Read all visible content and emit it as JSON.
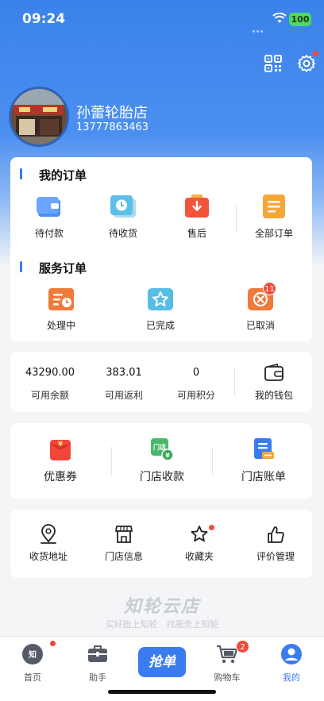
{
  "status_bar": {
    "time": "09:24",
    "battery": "100"
  },
  "profile": {
    "shop_name": "孙蕾轮胎店",
    "phone": "13777863463"
  },
  "my_orders": {
    "title": "我的订单",
    "items": [
      {
        "label": "待付款",
        "icon": "wallet-icon"
      },
      {
        "label": "待收货",
        "icon": "clock-icon"
      },
      {
        "label": "售后",
        "icon": "after-sale-icon"
      },
      {
        "label": "全部订单",
        "icon": "document-list-icon"
      }
    ]
  },
  "service_orders": {
    "title": "服务订单",
    "items": [
      {
        "label": "处理中",
        "icon": "processing-icon"
      },
      {
        "label": "已完成",
        "icon": "star-icon"
      },
      {
        "label": "已取消",
        "icon": "cancel-icon",
        "badge": "11"
      }
    ]
  },
  "wallet": {
    "items": [
      {
        "value": "43290.00",
        "label": "可用余额"
      },
      {
        "value": "383.01",
        "label": "可用返利"
      },
      {
        "value": "0",
        "label": "可用积分"
      }
    ],
    "my_wallet": "我的钱包"
  },
  "finance": {
    "items": [
      {
        "label": "优惠券",
        "icon": "coupon-icon"
      },
      {
        "label": "门店收款",
        "icon": "store-payment-icon"
      },
      {
        "label": "门店账单",
        "icon": "bill-icon"
      }
    ]
  },
  "tools": {
    "items": [
      {
        "label": "收货地址",
        "icon": "location-icon"
      },
      {
        "label": "门店信息",
        "icon": "store-icon"
      },
      {
        "label": "收藏夹",
        "icon": "favorite-star-icon"
      },
      {
        "label": "评价管理",
        "icon": "thumbs-up-icon"
      }
    ]
  },
  "footer_brand": {
    "logo": "知轮云店",
    "slogan": "买好胎上知轮　找服务上知轮"
  },
  "tabbar": {
    "tabs": [
      {
        "label": "首页"
      },
      {
        "label": "助手"
      },
      {
        "label": "抢单"
      },
      {
        "label": "购物车",
        "badge": "2"
      },
      {
        "label": "我的"
      }
    ]
  },
  "colors": {
    "accent": "#3a7cf0",
    "badge": "#f04a3e",
    "header": "#3a82ea"
  }
}
